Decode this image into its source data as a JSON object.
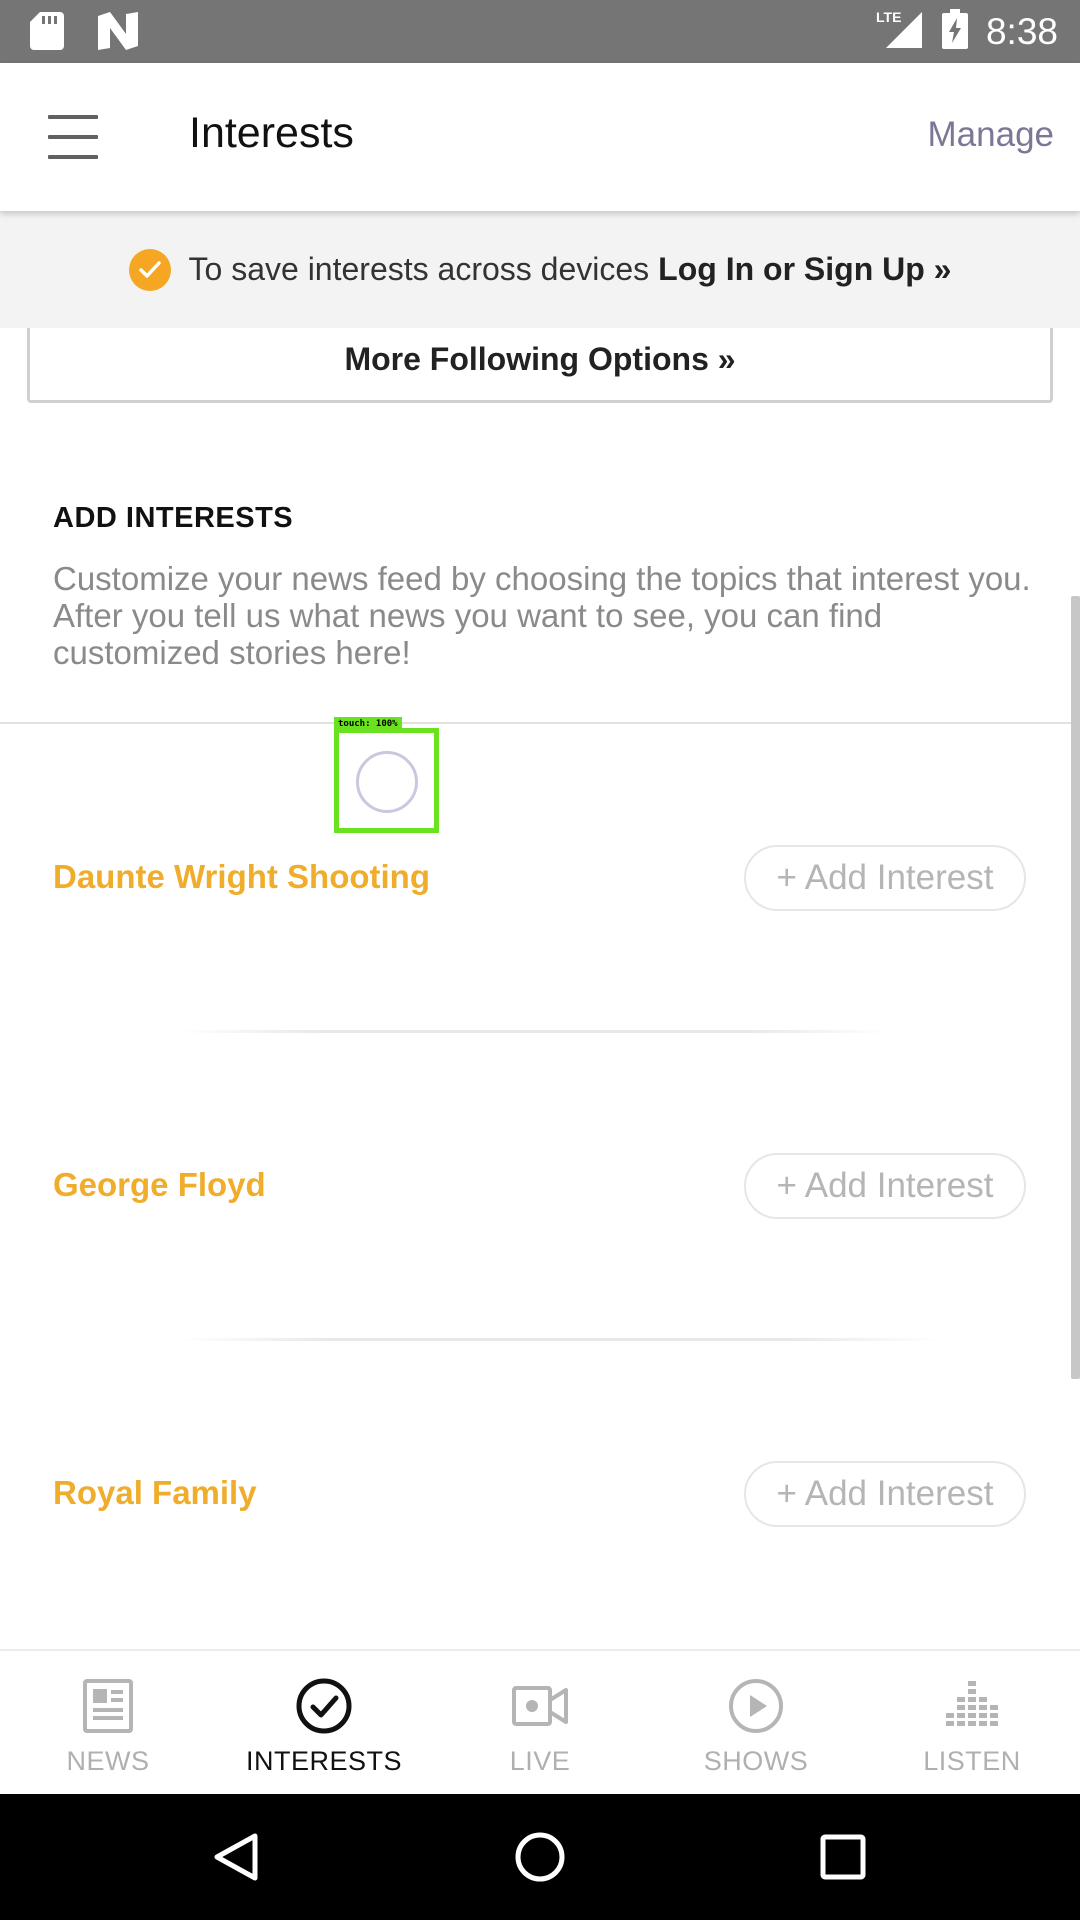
{
  "status_bar": {
    "time": "8:38",
    "network": "LTE",
    "icons": [
      "sd-card-icon",
      "n-logo-icon",
      "lte-signal-icon",
      "battery-charging-icon"
    ]
  },
  "app_bar": {
    "title": "Interests",
    "manage_label": "Manage"
  },
  "login_banner": {
    "text": "To save interests across devices",
    "link": "Log In or Sign Up »",
    "accent_color": "#f5a623"
  },
  "more_options_label": "More Following Options »",
  "add_interests": {
    "heading": "ADD INTERESTS",
    "description": "Customize your news feed by choosing the topics that interest you. After you tell us what news you want to see, you can find customized stories here!"
  },
  "interests": [
    {
      "name": "Daunte Wright Shooting",
      "button": "+ Add Interest"
    },
    {
      "name": "George Floyd",
      "button": "+ Add Interest"
    },
    {
      "name": "Royal Family",
      "button": "+ Add Interest"
    }
  ],
  "touch_indicator": {
    "label": "touch: 100%",
    "color": "#6be21f"
  },
  "bottom_nav": {
    "items": [
      {
        "label": "NEWS",
        "icon": "newspaper-icon",
        "active": false
      },
      {
        "label": "INTERESTS",
        "icon": "check-circle-icon",
        "active": true
      },
      {
        "label": "LIVE",
        "icon": "video-camera-icon",
        "active": false
      },
      {
        "label": "SHOWS",
        "icon": "play-circle-icon",
        "active": false
      },
      {
        "label": "LISTEN",
        "icon": "equalizer-icon",
        "active": false
      }
    ]
  },
  "system_nav": {
    "icons": [
      "back-icon",
      "home-icon",
      "recents-icon"
    ]
  },
  "colors": {
    "interest_name": "#f0ad2c",
    "manage": "#7a7896",
    "status_bar": "#757575"
  }
}
